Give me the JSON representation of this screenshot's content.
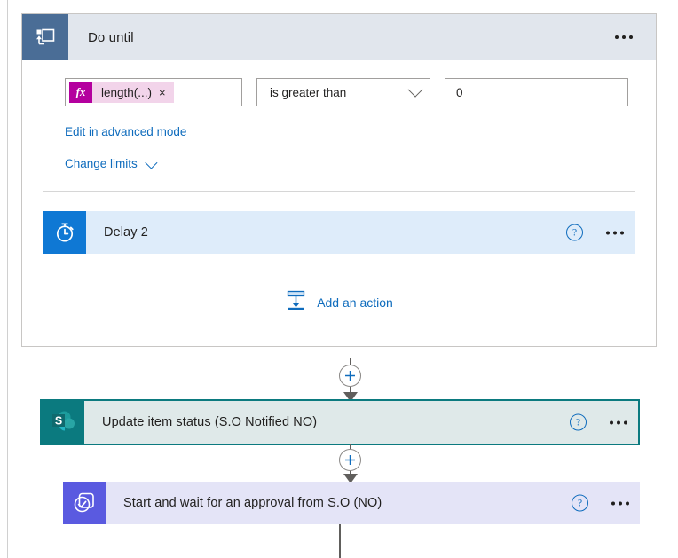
{
  "scope": {
    "title": "Do until",
    "icon": "do-until-loop-icon",
    "menu": "overflow-menu",
    "condition": {
      "expression_badge": "fx",
      "expression_token": "length(...)",
      "remove_token": "×",
      "operator": "is greater than",
      "operator_chevron": "chevron-down-icon",
      "value": "0"
    },
    "links": {
      "advanced_mode": "Edit in advanced mode",
      "change_limits": "Change limits",
      "change_limits_chevron": "chevron-down-icon"
    },
    "inner_action": {
      "title": "Delay 2",
      "icon": "stopwatch-icon",
      "help": "?",
      "menu": "overflow-menu"
    },
    "add_action": {
      "label": "Add an action",
      "icon": "insert-action-icon"
    }
  },
  "connectors": {
    "add_step_icon": "plus-circle-icon",
    "arrow_icon": "arrow-down-icon"
  },
  "actions": [
    {
      "title": "Update item status (S.O Notified NO)",
      "icon": "sharepoint-icon",
      "help": "?",
      "menu": "overflow-menu",
      "selected": true
    },
    {
      "title": "Start and wait for an approval from S.O (NO)",
      "icon": "approvals-icon",
      "help": "?",
      "menu": "overflow-menu",
      "selected": false
    }
  ],
  "colors": {
    "scope_header": "#e1e6ed",
    "scope_icon": "#4a6d96",
    "delay_icon": "#0f78d4",
    "delay_card": "#deecfa",
    "sharepoint": "#0b7a7f",
    "sharepoint_card": "#dfe9e9",
    "approvals": "#5a5ae0",
    "approvals_card": "#e4e4f7",
    "link": "#0f6cbd",
    "token_badge": "#b4009e",
    "token_pill": "#f2d4ea"
  }
}
